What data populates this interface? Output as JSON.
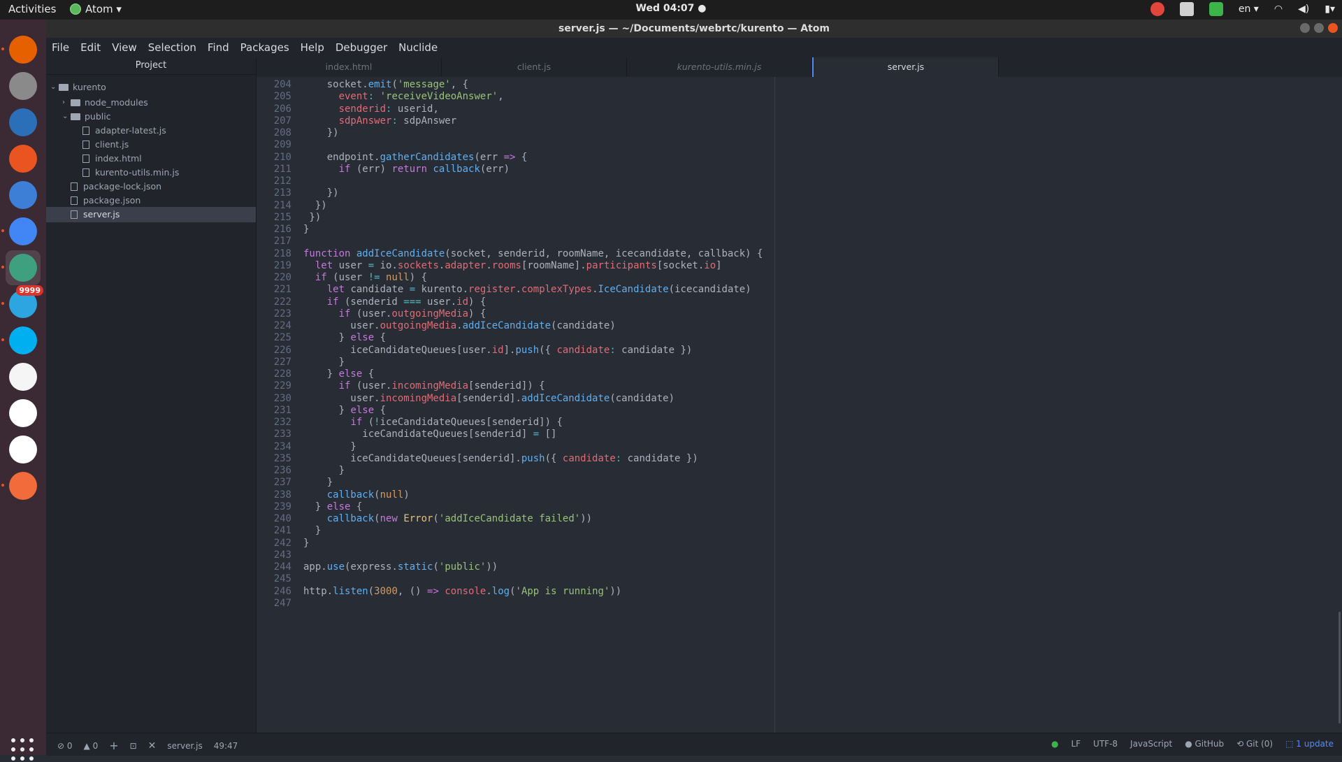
{
  "topbar": {
    "activities": "Activities",
    "app": "Atom ▾",
    "clock": "Wed 04:07 ●",
    "lang": "en ▾"
  },
  "window": {
    "title": "server.js — ~/Documents/webrtc/kurento — Atom"
  },
  "menu": [
    "File",
    "Edit",
    "View",
    "Selection",
    "Find",
    "Packages",
    "Help",
    "Debugger",
    "Nuclide"
  ],
  "dock": {
    "telegram_badge": "9999",
    "icons": [
      "firefox-icon",
      "files-icon",
      "writer-icon",
      "software-center-icon",
      "help-icon",
      "chrome-icon",
      "atom-icon",
      "telegram-icon",
      "skype-icon",
      "text-editor-icon",
      "mongodb-icon",
      "slack-icon",
      "postman-icon"
    ],
    "colors": [
      "#e66000",
      "#8a8a8a",
      "#2a6fb7",
      "#e95420",
      "#3d7fd6",
      "#4285f4",
      "#3ea07f",
      "#2ca5e0",
      "#00aff0",
      "#f5f5f5",
      "#ffffff",
      "#ffffff",
      "#f26b3a"
    ]
  },
  "tree": {
    "header": "Project",
    "nodes": [
      {
        "label": "kurento",
        "type": "folder",
        "open": true,
        "depth": 0
      },
      {
        "label": "node_modules",
        "type": "folder",
        "open": false,
        "depth": 1
      },
      {
        "label": "public",
        "type": "folder",
        "open": true,
        "depth": 1
      },
      {
        "label": "adapter-latest.js",
        "type": "file",
        "depth": 2
      },
      {
        "label": "client.js",
        "type": "file",
        "depth": 2
      },
      {
        "label": "index.html",
        "type": "file",
        "depth": 2
      },
      {
        "label": "kurento-utils.min.js",
        "type": "file",
        "depth": 2
      },
      {
        "label": "package-lock.json",
        "type": "file",
        "depth": 1
      },
      {
        "label": "package.json",
        "type": "file",
        "depth": 1
      },
      {
        "label": "server.js",
        "type": "file",
        "depth": 1,
        "selected": true
      }
    ]
  },
  "tabs": [
    {
      "label": "index.html"
    },
    {
      "label": "client.js"
    },
    {
      "label": "kurento-utils.min.js",
      "italic": true
    },
    {
      "label": "server.js",
      "active": true
    }
  ],
  "editor": {
    "first_line": 204,
    "lines": [
      [
        [
          "",
          "    socket."
        ],
        [
          "f",
          "emit"
        ],
        [
          "",
          "("
        ],
        [
          "s",
          "'message'"
        ],
        [
          "",
          ", {"
        ]
      ],
      [
        [
          "",
          "      "
        ],
        [
          "p",
          "event"
        ],
        [
          "o",
          ":"
        ],
        [
          "",
          ""
        ],
        [
          "s",
          " 'receiveVideoAnswer'"
        ],
        [
          "",
          ","
        ]
      ],
      [
        [
          "",
          "      "
        ],
        [
          "p",
          "senderid"
        ],
        [
          "o",
          ":"
        ],
        [
          "",
          " userid,"
        ]
      ],
      [
        [
          "",
          "      "
        ],
        [
          "p",
          "sdpAnswer"
        ],
        [
          "o",
          ":"
        ],
        [
          "",
          " sdpAnswer"
        ]
      ],
      [
        [
          "",
          "    })"
        ]
      ],
      [
        [
          "",
          ""
        ]
      ],
      [
        [
          "",
          "    endpoint."
        ],
        [
          "f",
          "gatherCandidates"
        ],
        [
          "",
          "(err "
        ],
        [
          "k",
          "=>"
        ],
        [
          "",
          " {"
        ]
      ],
      [
        [
          "",
          "      "
        ],
        [
          "k",
          "if"
        ],
        [
          "",
          " (err) "
        ],
        [
          "k",
          "return"
        ],
        [
          "",
          ""
        ],
        [
          "f",
          " callback"
        ],
        [
          "",
          "(err)"
        ]
      ],
      [
        [
          "",
          ""
        ]
      ],
      [
        [
          "",
          "    })"
        ]
      ],
      [
        [
          "",
          "  })"
        ]
      ],
      [
        [
          "",
          " })"
        ]
      ],
      [
        [
          "",
          "}"
        ]
      ],
      [
        [
          "",
          ""
        ]
      ],
      [
        [
          "k",
          "function"
        ],
        [
          "f",
          " addIceCandidate"
        ],
        [
          "",
          "(socket, senderid, roomName, icecandidate, callback) {"
        ]
      ],
      [
        [
          "",
          "  "
        ],
        [
          "k",
          "let"
        ],
        [
          "",
          " user "
        ],
        [
          "o",
          "="
        ],
        [
          "",
          " io."
        ],
        [
          "p",
          "sockets"
        ],
        [
          "",
          "."
        ],
        [
          "p",
          "adapter"
        ],
        [
          "",
          "."
        ],
        [
          "p",
          "rooms"
        ],
        [
          "",
          "[roomName]."
        ],
        [
          "p",
          "participants"
        ],
        [
          "",
          "[socket."
        ],
        [
          "p",
          "io"
        ],
        [
          "",
          "]"
        ]
      ],
      [
        [
          "",
          "  "
        ],
        [
          "k",
          "if"
        ],
        [
          "",
          " (user "
        ],
        [
          "o",
          "!="
        ],
        [
          "",
          ""
        ],
        [
          "n",
          " null"
        ],
        [
          "",
          ") {"
        ]
      ],
      [
        [
          "",
          "    "
        ],
        [
          "k",
          "let"
        ],
        [
          "",
          " candidate "
        ],
        [
          "o",
          "="
        ],
        [
          "",
          " kurento."
        ],
        [
          "p",
          "register"
        ],
        [
          "",
          "."
        ],
        [
          "p",
          "complexTypes"
        ],
        [
          "",
          "."
        ],
        [
          "f",
          "IceCandidate"
        ],
        [
          "",
          "(icecandidate)"
        ]
      ],
      [
        [
          "",
          "    "
        ],
        [
          "k",
          "if"
        ],
        [
          "",
          " (senderid "
        ],
        [
          "o",
          "==="
        ],
        [
          "",
          " user."
        ],
        [
          "p",
          "id"
        ],
        [
          "",
          ") {"
        ]
      ],
      [
        [
          "",
          "      "
        ],
        [
          "k",
          "if"
        ],
        [
          "",
          " (user."
        ],
        [
          "p",
          "outgoingMedia"
        ],
        [
          "",
          ") {"
        ]
      ],
      [
        [
          "",
          "        user."
        ],
        [
          "p",
          "outgoingMedia"
        ],
        [
          "",
          "."
        ],
        [
          "f",
          "addIceCandidate"
        ],
        [
          "",
          "(candidate)"
        ]
      ],
      [
        [
          "",
          "      } "
        ],
        [
          "k",
          "else"
        ],
        [
          "",
          " {"
        ]
      ],
      [
        [
          "",
          "        iceCandidateQueues[user."
        ],
        [
          "p",
          "id"
        ],
        [
          "",
          "]."
        ],
        [
          "f",
          "push"
        ],
        [
          "",
          "({ "
        ],
        [
          "p",
          "candidate"
        ],
        [
          "o",
          ":"
        ],
        [
          "",
          " candidate })"
        ]
      ],
      [
        [
          "",
          "      }"
        ]
      ],
      [
        [
          "",
          "    } "
        ],
        [
          "k",
          "else"
        ],
        [
          "",
          " {"
        ]
      ],
      [
        [
          "",
          "      "
        ],
        [
          "k",
          "if"
        ],
        [
          "",
          " (user."
        ],
        [
          "p",
          "incomingMedia"
        ],
        [
          "",
          "[senderid]) {"
        ]
      ],
      [
        [
          "",
          "        user."
        ],
        [
          "p",
          "incomingMedia"
        ],
        [
          "",
          "[senderid]."
        ],
        [
          "f",
          "addIceCandidate"
        ],
        [
          "",
          "(candidate)"
        ]
      ],
      [
        [
          "",
          "      } "
        ],
        [
          "k",
          "else"
        ],
        [
          "",
          " {"
        ]
      ],
      [
        [
          "",
          "        "
        ],
        [
          "k",
          "if"
        ],
        [
          "",
          " ("
        ],
        [
          "o",
          "!"
        ],
        [
          "",
          "iceCandidateQueues[senderid]) {"
        ]
      ],
      [
        [
          "",
          "          iceCandidateQueues[senderid] "
        ],
        [
          "o",
          "="
        ],
        [
          "",
          " []"
        ]
      ],
      [
        [
          "",
          "        }"
        ]
      ],
      [
        [
          "",
          "        iceCandidateQueues[senderid]."
        ],
        [
          "f",
          "push"
        ],
        [
          "",
          "({ "
        ],
        [
          "p",
          "candidate"
        ],
        [
          "o",
          ":"
        ],
        [
          "",
          " candidate })"
        ]
      ],
      [
        [
          "",
          "      }"
        ]
      ],
      [
        [
          "",
          "    }"
        ]
      ],
      [
        [
          "",
          "    "
        ],
        [
          "f",
          "callback"
        ],
        [
          "",
          "("
        ],
        [
          "n",
          "null"
        ],
        [
          "",
          ")"
        ]
      ],
      [
        [
          "",
          "  } "
        ],
        [
          "k",
          "else"
        ],
        [
          "",
          " {"
        ]
      ],
      [
        [
          "",
          "    "
        ],
        [
          "f",
          "callback"
        ],
        [
          "",
          "("
        ],
        [
          "k",
          "new"
        ],
        [
          "c",
          " Error"
        ],
        [
          "",
          "("
        ],
        [
          "s",
          "'addIceCandidate failed'"
        ],
        [
          "",
          "))"
        ]
      ],
      [
        [
          "",
          "  }"
        ]
      ],
      [
        [
          "",
          "}"
        ]
      ],
      [
        [
          "",
          ""
        ]
      ],
      [
        [
          "",
          "app."
        ],
        [
          "f",
          "use"
        ],
        [
          "",
          "(express."
        ],
        [
          "f",
          "static"
        ],
        [
          "",
          "("
        ],
        [
          "s",
          "'public'"
        ],
        [
          "",
          "))"
        ]
      ],
      [
        [
          "",
          ""
        ]
      ],
      [
        [
          "",
          "http."
        ],
        [
          "f",
          "listen"
        ],
        [
          "",
          "("
        ],
        [
          "n",
          "3000"
        ],
        [
          "",
          ", () "
        ],
        [
          "k",
          "=>"
        ],
        [
          "",
          ""
        ],
        [
          "p",
          " console"
        ],
        [
          "",
          "."
        ],
        [
          "f",
          "log"
        ],
        [
          "",
          "("
        ],
        [
          "s",
          "'App is running'"
        ],
        [
          "",
          "))"
        ]
      ],
      [
        [
          "",
          ""
        ]
      ]
    ]
  },
  "status": {
    "errors": "0",
    "warnings": "0",
    "file": "server.js",
    "cursor": "49:47",
    "eol": "LF",
    "encoding": "UTF-8",
    "grammar": "JavaScript",
    "github": "GitHub",
    "git": "Git (0)",
    "update": "1 update"
  }
}
